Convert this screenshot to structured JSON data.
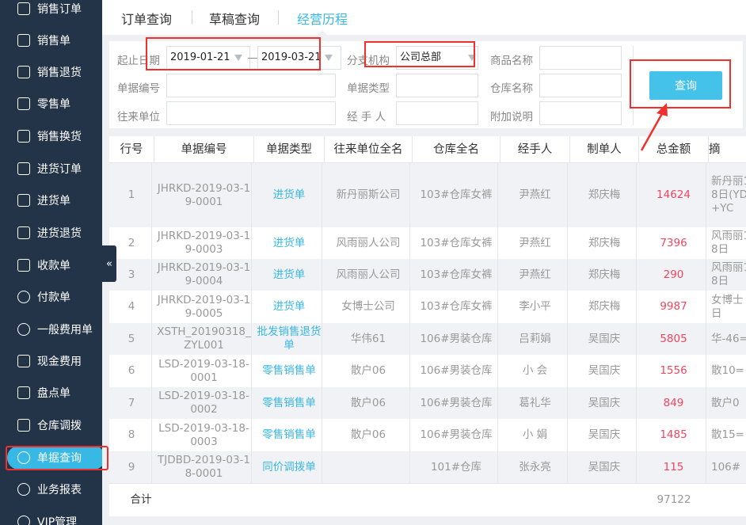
{
  "sidebar": {
    "items": [
      {
        "label": "销售订单",
        "icon": "sales-order-icon"
      },
      {
        "label": "销售单",
        "icon": "sales-icon"
      },
      {
        "label": "销售退货",
        "icon": "sales-return-icon"
      },
      {
        "label": "零售单",
        "icon": "retail-icon"
      },
      {
        "label": "销售换货",
        "icon": "exchange-icon"
      },
      {
        "label": "进货订单",
        "icon": "purchase-order-icon"
      },
      {
        "label": "进货单",
        "icon": "purchase-icon"
      },
      {
        "label": "进货退货",
        "icon": "purchase-return-icon"
      },
      {
        "label": "收款单",
        "icon": "receipt-icon"
      },
      {
        "label": "付款单",
        "icon": "payment-icon"
      },
      {
        "label": "一般费用单",
        "icon": "yen-icon"
      },
      {
        "label": "现金费用",
        "icon": "cash-icon"
      },
      {
        "label": "盘点单",
        "icon": "inventory-icon"
      },
      {
        "label": "仓库调拨",
        "icon": "transfer-icon"
      },
      {
        "label": "单据查询",
        "icon": "search-doc-icon"
      },
      {
        "label": "业务报表",
        "icon": "pie-chart-icon"
      },
      {
        "label": "VIP管理",
        "icon": "vip-icon"
      }
    ],
    "active_index": 14,
    "collapse_glyph": "«"
  },
  "tabs": [
    {
      "label": "订单查询"
    },
    {
      "label": "草稿查询"
    },
    {
      "label": "经营历程"
    }
  ],
  "filters": {
    "date_label": "起止日期",
    "date_from": "2019-01-21",
    "date_sep": "—",
    "date_to": "2019-03-21",
    "branch_label": "分支机构",
    "branch_value": "公司总部",
    "product_label": "商品名称",
    "doc_no_label": "单据编号",
    "doc_type_label": "单据类型",
    "warehouse_label": "仓库名称",
    "partner_label": "往来单位",
    "handler_label": "经 手 人",
    "remark_label": "附加说明",
    "query_label": "查询"
  },
  "table": {
    "headers": [
      "行号",
      "单据编号",
      "单据类型",
      "往来单位全名",
      "仓库全名",
      "经手人",
      "制单人",
      "总金额",
      "摘"
    ],
    "rows": [
      {
        "no": "1",
        "doc_no": "JHRKD-2019-03-19-0001",
        "type": "进货单",
        "partner": "新丹丽斯公司",
        "warehouse": "103#仓库女裤",
        "handler": "尹燕红",
        "maker": "郑庆梅",
        "amount": "14624",
        "summary": "新丹丽18日(YD+YC"
      },
      {
        "no": "2",
        "doc_no": "JHRKD-2019-03-19-0003",
        "type": "进货单",
        "partner": "风雨丽人公司",
        "warehouse": "103#仓库女裤",
        "handler": "尹燕红",
        "maker": "郑庆梅",
        "amount": "7396",
        "summary": "风雨丽18日"
      },
      {
        "no": "3",
        "doc_no": "JHRKD-2019-03-19-0004",
        "type": "进货单",
        "partner": "风雨丽人公司",
        "warehouse": "103#仓库女裤",
        "handler": "尹燕红",
        "maker": "郑庆梅",
        "amount": "290",
        "summary": "风雨丽18日"
      },
      {
        "no": "4",
        "doc_no": "JHRKD-2019-03-19-0005",
        "type": "进货单",
        "partner": "女博士公司",
        "warehouse": "103#仓库女裤",
        "handler": "李小平",
        "maker": "郑庆梅",
        "amount": "9987",
        "summary": "女博士日"
      },
      {
        "no": "5",
        "doc_no": "XSTH_20190318_ZYL001",
        "type": "批发销售退货单",
        "partner": "华伟61",
        "warehouse": "106#男装仓库",
        "handler": "吕莉娟",
        "maker": "吴国庆",
        "amount": "5805",
        "summary": "华-46="
      },
      {
        "no": "6",
        "doc_no": "LSD-2019-03-18-0001",
        "type": "零售销售单",
        "partner": "散户06",
        "warehouse": "106#男装仓库",
        "handler": "小 会",
        "maker": "吴国庆",
        "amount": "1556",
        "summary": "散10="
      },
      {
        "no": "7",
        "doc_no": "LSD-2019-03-18-0002",
        "type": "零售销售单",
        "partner": "散户06",
        "warehouse": "106#男装仓库",
        "handler": "葛礼华",
        "maker": "吴国庆",
        "amount": "849",
        "summary": "散户0"
      },
      {
        "no": "8",
        "doc_no": "LSD-2019-03-18-0003",
        "type": "零售销售单",
        "partner": "散户06",
        "warehouse": "106#男装仓库",
        "handler": "小 娟",
        "maker": "吴国庆",
        "amount": "1485",
        "summary": "散15="
      },
      {
        "no": "9",
        "doc_no": "TJDBD-2019-03-18-0001",
        "type": "同价调拨单",
        "partner": "",
        "warehouse": "101#仓库",
        "handler": "张永亮",
        "maker": "吴国庆",
        "amount": "115",
        "summary": "106#"
      }
    ],
    "total_label": "合计",
    "total_amount": "97122"
  },
  "colors": {
    "accent": "#37b8e5",
    "sidebar": "#243448",
    "amount": "#f0465f",
    "annotation": "#f0302d"
  }
}
